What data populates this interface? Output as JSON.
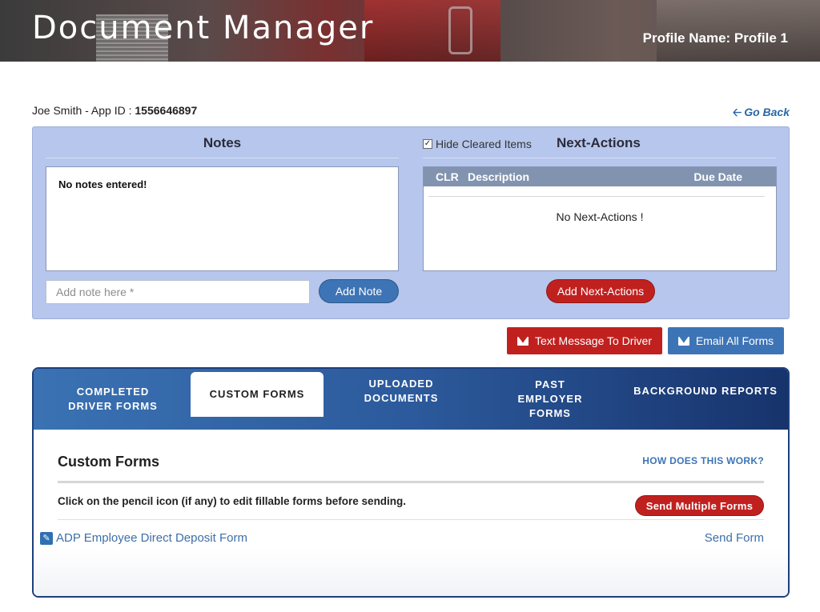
{
  "header": {
    "title": "Document Manager",
    "profile": "Profile Name: Profile 1"
  },
  "applicant": {
    "name": "Joe  Smith",
    "app_id_label": " - App ID : ",
    "app_id": "1556646897",
    "go_back": "Go Back"
  },
  "notes": {
    "heading": "Notes",
    "empty_message": "No notes entered!",
    "input_placeholder": "Add note here *",
    "add_button": "Add Note"
  },
  "next_actions": {
    "hide_cleared_label": "Hide Cleared Items",
    "hide_cleared_checked": true,
    "heading": "Next-Actions",
    "columns": [
      "CLR",
      "Description",
      "Due Date"
    ],
    "empty_message": "No Next-Actions !",
    "add_button": "Add Next-Actions"
  },
  "actions": {
    "text_driver": "Text Message To Driver",
    "email_forms": "Email All Forms"
  },
  "tabs": [
    {
      "label": "COMPLETED DRIVER FORMS",
      "active": false
    },
    {
      "label": "CUSTOM FORMS",
      "active": true
    },
    {
      "label": "UPLOADED DOCUMENTS",
      "active": false
    },
    {
      "label": "PAST EMPLOYER FORMS",
      "active": false
    },
    {
      "label": "BACKGROUND REPORTS",
      "active": false
    }
  ],
  "custom_forms": {
    "title": "Custom Forms",
    "how_link": "HOW DOES THIS WORK?",
    "instruction": "Click on the pencil icon (if any) to edit fillable forms before sending.",
    "send_multiple": "Send Multiple Forms",
    "forms": [
      {
        "name": "ADP Employee Direct Deposit Form",
        "action": "Send Form"
      }
    ]
  },
  "colors": {
    "panel_bg": "#b6c6ec",
    "primary_blue": "#3d74b6",
    "danger_red": "#c0211f",
    "tab_dark": "#17336c"
  }
}
